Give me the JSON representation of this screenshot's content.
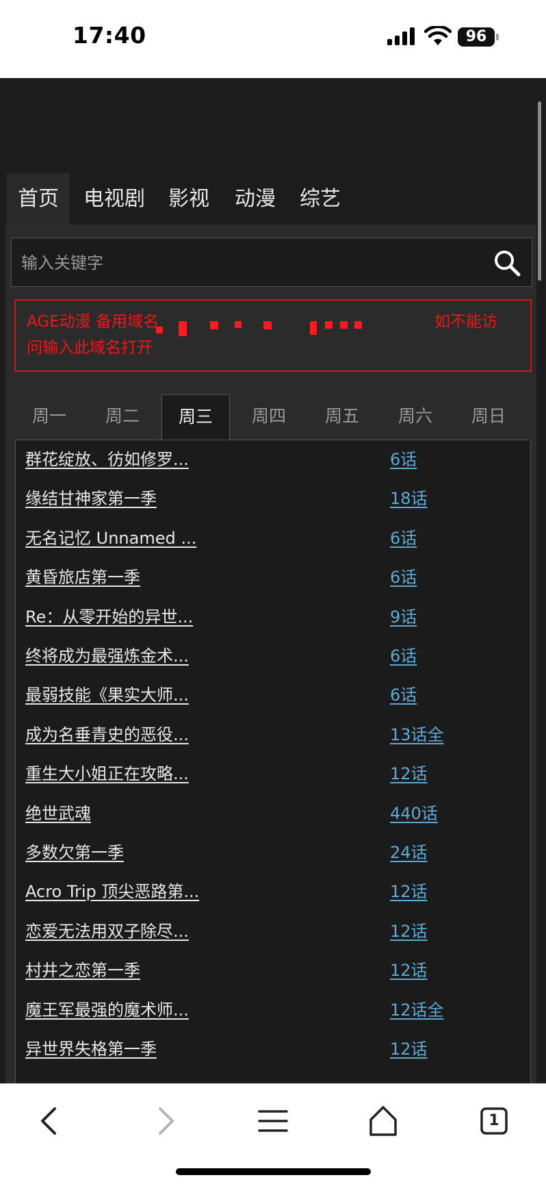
{
  "status_bar": {
    "time": "17:40",
    "battery": "96"
  },
  "nav": {
    "items": [
      "首页",
      "电视剧",
      "影视",
      "动漫",
      "综艺"
    ],
    "active_index": 0
  },
  "search": {
    "placeholder": "输入关键字"
  },
  "notice": {
    "prefix": "AGE动漫 备用域名",
    "suffix": "如不能访",
    "line2": "问输入此域名打开"
  },
  "weekday_tabs": {
    "items": [
      "周一",
      "周二",
      "周三",
      "周四",
      "周五",
      "周六",
      "周日"
    ],
    "active_index": 2
  },
  "schedule": [
    {
      "title": "群花绽放、彷如修罗...",
      "episode": "6话"
    },
    {
      "title": "缘结甘神家第一季",
      "episode": "18话"
    },
    {
      "title": "无名记忆 Unnamed ...",
      "episode": "6话"
    },
    {
      "title": "黄昏旅店第一季",
      "episode": "6话"
    },
    {
      "title": "Re：从零开始的异世...",
      "episode": "9话"
    },
    {
      "title": "终将成为最强炼金术...",
      "episode": "6话"
    },
    {
      "title": "最弱技能《果实大师...",
      "episode": "6话"
    },
    {
      "title": "成为名垂青史的恶役...",
      "episode": "13话全"
    },
    {
      "title": "重生大小姐正在攻略...",
      "episode": "12话"
    },
    {
      "title": "绝世武魂",
      "episode": "440话"
    },
    {
      "title": "多数欠第一季",
      "episode": "24话"
    },
    {
      "title": "Acro Trip 顶尖恶路第...",
      "episode": "12话"
    },
    {
      "title": "恋爱无法用双子除尽...",
      "episode": "12话"
    },
    {
      "title": "村井之恋第一季",
      "episode": "12话"
    },
    {
      "title": "魔王军最强的魔术师...",
      "episode": "12话全"
    },
    {
      "title": "异世界失格第一季",
      "episode": "12话"
    }
  ],
  "toolbar": {
    "tab_count": "1"
  },
  "colors": {
    "page_bg": "#1c1c1c",
    "notice_red": "#f2151a",
    "link_blue": "#5fa9d6"
  }
}
